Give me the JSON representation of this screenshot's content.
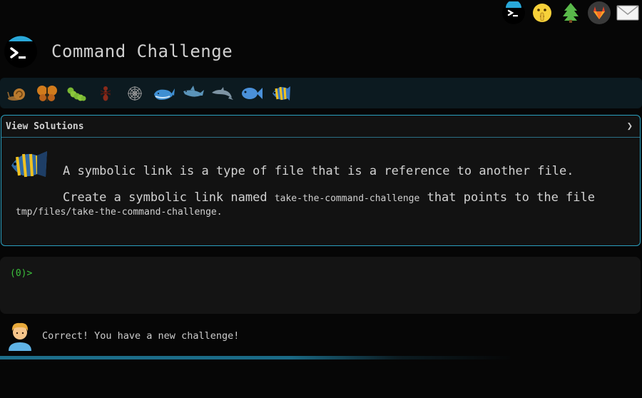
{
  "header": {
    "title": "Command Challenge"
  },
  "top_icons": [
    "terminal-icon",
    "shushing-face-icon",
    "tree-icon",
    "gitlab-icon",
    "mail-icon"
  ],
  "levels": [
    "snail-icon",
    "butterfly-icon",
    "caterpillar-icon",
    "ant-icon",
    "spider-web-icon",
    "whale-icon",
    "shark-icon",
    "dolphin-icon",
    "fish-icon",
    "tropical-fish-icon"
  ],
  "challenge": {
    "toggle_label": "View Solutions",
    "chevron": "❯",
    "intro": "A symbolic link is a type of file that is a reference to another file.",
    "task_prefix": "Create a symbolic link named",
    "link_name": "take-the-command-challenge",
    "task_middle": "that points to the file",
    "target_path": "tmp/files/take-the-command-challenge",
    "task_suffix": "."
  },
  "terminal": {
    "prompt": "(0)>",
    "value": ""
  },
  "feedback": {
    "message": "Correct! You have a new challenge!"
  },
  "colors": {
    "accent": "#2a9fbf",
    "prompt": "#3cc03c",
    "background": "#060606"
  }
}
